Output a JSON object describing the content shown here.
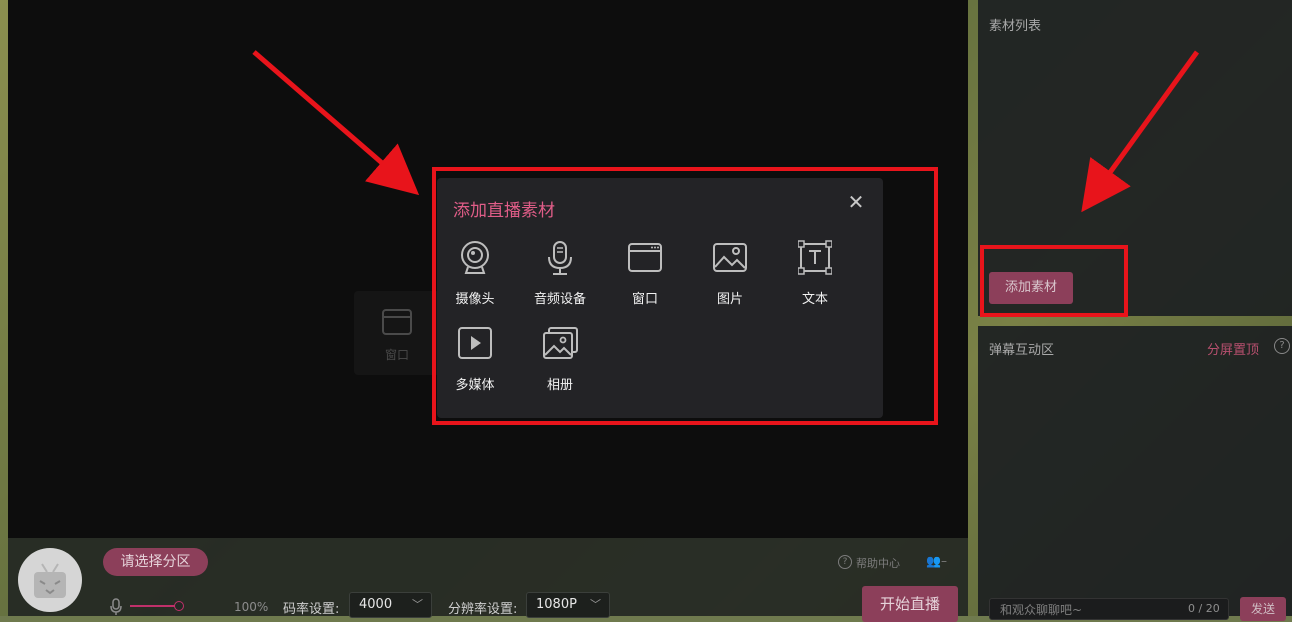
{
  "dialog": {
    "title": "添加直播素材",
    "close_icon": "close-icon",
    "tools": [
      {
        "label": "摄像头",
        "icon": "camera-icon"
      },
      {
        "label": "音频设备",
        "icon": "microphone-icon"
      },
      {
        "label": "窗口",
        "icon": "window-icon"
      },
      {
        "label": "图片",
        "icon": "image-icon"
      },
      {
        "label": "文本",
        "icon": "text-icon"
      },
      {
        "label": "多媒体",
        "icon": "media-play-icon"
      },
      {
        "label": "相册",
        "icon": "album-icon"
      }
    ]
  },
  "preview": {
    "ghost_tile_label": "窗口"
  },
  "asset_panel": {
    "title": "素材列表",
    "add_button": "添加素材"
  },
  "danmu_panel": {
    "title": "弹幕互动区",
    "pin_label": "分屏置顶",
    "chat_placeholder": "和观众聊聊吧~",
    "chat_count": "0 / 20",
    "send_button": "发送"
  },
  "bottom_bar": {
    "category_button": "请选择分区",
    "help_center": "帮助中心",
    "volume_percent": "100%",
    "bitrate_label": "码率设置:",
    "bitrate_value": "4000",
    "resolution_label": "分辨率设置:",
    "resolution_value": "1080P",
    "start_button": "开始直播"
  },
  "colors": {
    "accent": "#e05d88",
    "button_bg": "#8c3f5a",
    "annotation_red": "#e8141b"
  }
}
